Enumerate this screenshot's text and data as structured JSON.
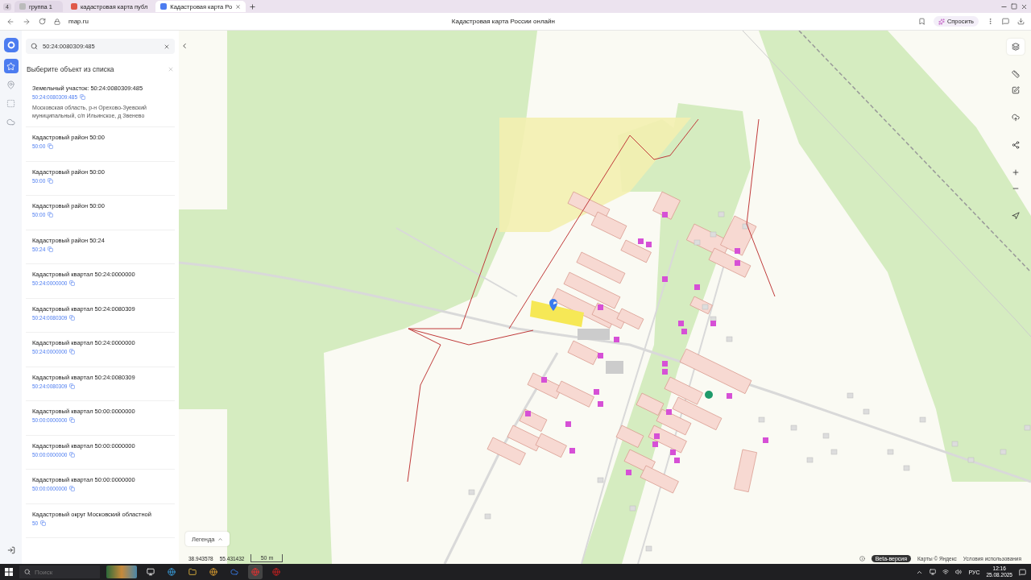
{
  "browser": {
    "tab_count": "4",
    "tabs": [
      {
        "label": "группа 1",
        "kind": "group",
        "selected": false
      },
      {
        "label": "кадастровая карта публ",
        "kind": "page",
        "selected": false
      },
      {
        "label": "Кадастровая карта Ро",
        "kind": "page",
        "selected": true
      }
    ],
    "address": "map.ru",
    "page_title": "Кадастровая карта России онлайн",
    "ask_button": "Спросить"
  },
  "rail": [
    {
      "kind": "favorites",
      "selected": true
    },
    {
      "kind": "pin",
      "selected": false
    },
    {
      "kind": "area",
      "selected": false
    },
    {
      "kind": "cloud",
      "selected": false
    }
  ],
  "search": {
    "value": "50:24:0080309:485"
  },
  "results": {
    "title": "Выберите объект из списка",
    "items": [
      {
        "title": "Земельный участок: 50:24:0080309:485",
        "number": "50:24:0080309:485",
        "address": "Московская область, р-н Орехово-Зуевский муниципальный, с/п Ильинское, д Звенево"
      },
      {
        "title": "Кадастровый район 50:00",
        "number": "50:00"
      },
      {
        "title": "Кадастровый район 50:00",
        "number": "50:00"
      },
      {
        "title": "Кадастровый район 50:00",
        "number": "50:00"
      },
      {
        "title": "Кадастровый район 50:24",
        "number": "50:24"
      },
      {
        "title": "Кадастровый квартал 50:24:0000000",
        "number": "50:24:0000000"
      },
      {
        "title": "Кадастровый квартал 50:24:0080309",
        "number": "50:24:0080309"
      },
      {
        "title": "Кадастровый квартал 50:24:0000000",
        "number": "50:24:0000000"
      },
      {
        "title": "Кадастровый квартал 50:24:0080309",
        "number": "50:24:0080309"
      },
      {
        "title": "Кадастровый квартал 50:00:0000000",
        "number": "50:00:0000000"
      },
      {
        "title": "Кадастровый квартал 50:00:0000000",
        "number": "50:00:0000000"
      },
      {
        "title": "Кадастровый квартал 50:00:0000000",
        "number": "50:00:0000000"
      },
      {
        "title": "Кадастровый округ Московский областной",
        "number": "50"
      }
    ]
  },
  "map": {
    "legend_button": "Легенда",
    "longitude": "38.943578",
    "latitude": "55.431432",
    "scale": "50 m",
    "beta_badge": "Beta-версия",
    "attribution": "Карты © Яндекс",
    "terms_link": "Условия использования"
  },
  "taskbar": {
    "search_placeholder": "Поиск",
    "language": "РУС",
    "time": "12:16",
    "date": "25.08.2025"
  }
}
